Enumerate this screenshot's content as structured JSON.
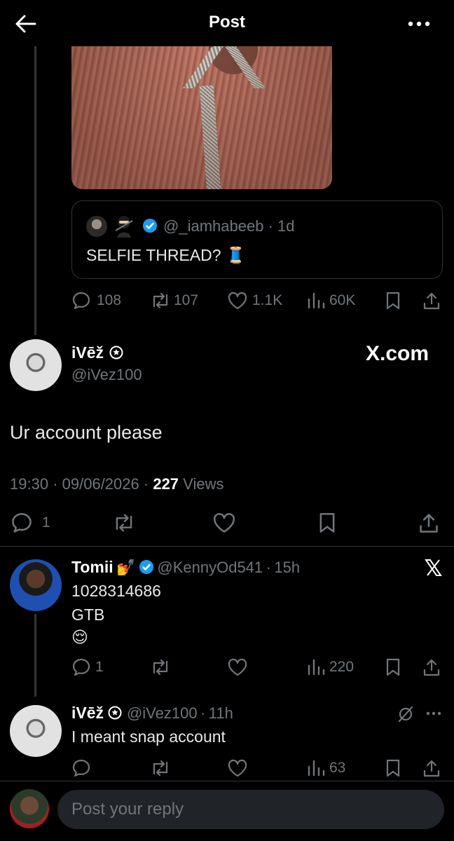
{
  "header": {
    "title": "Post"
  },
  "quoted_post": {
    "handle": "@_iamhabeeb",
    "time": "1d",
    "text": "SELFIE THREAD? 🧵"
  },
  "parent_stats": {
    "replies": "108",
    "reposts": "107",
    "likes": "1.1K",
    "views": "60K"
  },
  "main_post": {
    "name": "iVēž",
    "handle": "@iVez100",
    "watermark": "X.com",
    "text": "Ur account please",
    "time": "19:30",
    "date": "09/06/2026",
    "views_count": "227",
    "views_label": "Views",
    "reply_count": "1"
  },
  "replies": [
    {
      "name": "Tomii",
      "name_emoji": "💅",
      "handle": "@KennyOd541",
      "time": "15h",
      "lines": [
        "1028314686",
        "GTB",
        "😌"
      ],
      "stats": {
        "replies": "1",
        "views": "220"
      }
    },
    {
      "name": "iVēž",
      "handle": "@iVez100",
      "time": "11h",
      "text": "I meant snap account",
      "stats": {
        "views": "63"
      }
    }
  ],
  "composer": {
    "placeholder": "Post your reply"
  },
  "colors": {
    "background": "#000000",
    "muted": "#71767b",
    "verified": "#1d9bf0",
    "divider": "#2f3336"
  }
}
